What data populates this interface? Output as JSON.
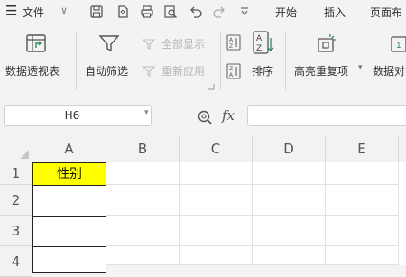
{
  "menubar": {
    "hamburger": "☰",
    "file": "文件",
    "chevron": "∨",
    "tabs": [
      "开始",
      "插入",
      "页面布"
    ]
  },
  "ribbon": {
    "pivot": "数据透视表",
    "autofilter": "自动筛选",
    "show_all": "全部显示",
    "reapply": "重新应用",
    "sort": "排序",
    "highlight_dup": "高亮重复项",
    "data_compare": "数据对"
  },
  "formula_bar": {
    "name_box_value": "H6",
    "fx_label": "fx",
    "formula_value": ""
  },
  "sheet": {
    "columns": [
      "A",
      "B",
      "C",
      "D",
      "E"
    ],
    "rows": [
      "1",
      "2",
      "3",
      "4"
    ],
    "cell_A1": "性别",
    "highlight_color": "#ffff00"
  }
}
